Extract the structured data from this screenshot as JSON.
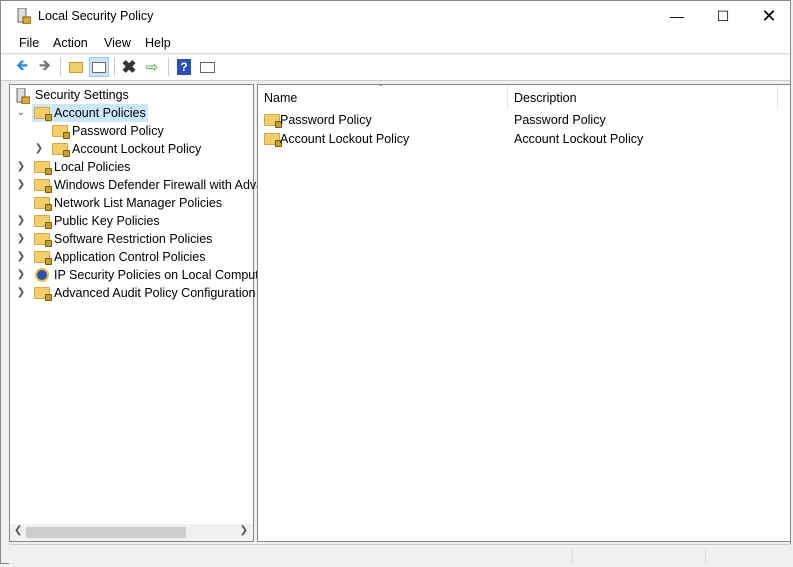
{
  "window": {
    "title": "Local Security Policy"
  },
  "menu": [
    "File",
    "Action",
    "View",
    "Help"
  ],
  "tree": {
    "root": "Security Settings",
    "items": [
      {
        "label": "Account Policies",
        "level": 1,
        "expanded": true,
        "selected": true
      },
      {
        "label": "Password Policy",
        "level": 2,
        "expanded": null
      },
      {
        "label": "Account Lockout Policy",
        "level": 2,
        "expanded": false
      },
      {
        "label": "Local Policies",
        "level": 1,
        "expanded": false
      },
      {
        "label": "Windows Defender Firewall with Adva",
        "level": 1,
        "expanded": false
      },
      {
        "label": "Network List Manager Policies",
        "level": 1,
        "expanded": null
      },
      {
        "label": "Public Key Policies",
        "level": 1,
        "expanded": false
      },
      {
        "label": "Software Restriction Policies",
        "level": 1,
        "expanded": false
      },
      {
        "label": "Application Control Policies",
        "level": 1,
        "expanded": false
      },
      {
        "label": "IP Security Policies on Local Compute",
        "level": 1,
        "expanded": false,
        "icon": "ip-security"
      },
      {
        "label": "Advanced Audit Policy Configuration",
        "level": 1,
        "expanded": false
      }
    ]
  },
  "list": {
    "columns": [
      "Name",
      "Description"
    ],
    "rows": [
      {
        "name": "Password Policy",
        "description": "Password Policy"
      },
      {
        "name": "Account Lockout Policy",
        "description": "Account Lockout Policy"
      }
    ]
  }
}
